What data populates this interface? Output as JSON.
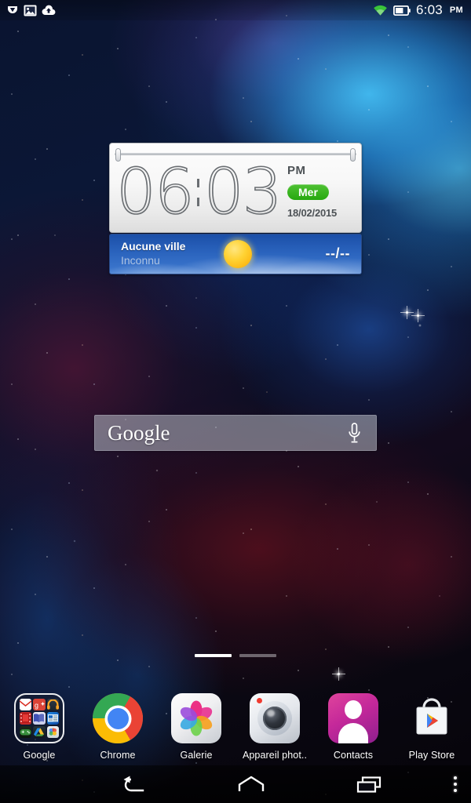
{
  "status_bar": {
    "left_icons": [
      {
        "name": "download-icon",
        "label": "download"
      },
      {
        "name": "image-icon",
        "label": "screenshot"
      },
      {
        "name": "cloud-upload-icon",
        "label": "cloud upload"
      }
    ],
    "right_icons": [
      {
        "name": "wifi-icon",
        "label": "wifi",
        "color": "#3ac43a"
      },
      {
        "name": "battery-icon",
        "label": "battery",
        "color": "#ffffff"
      }
    ],
    "time": "6:03",
    "ampm": "PM"
  },
  "clock_widget": {
    "hours": "06",
    "minutes": "03",
    "ampm": "PM",
    "day_badge": "Mer",
    "day_badge_color": "#34b01a",
    "date": "18/02/2015"
  },
  "weather_widget": {
    "city": "Aucune ville",
    "condition": "Inconnu",
    "icon": "sun-icon",
    "temperature": "--/--",
    "background_color": "#2a63bd"
  },
  "search_bar": {
    "label": "Google",
    "mic_icon": "microphone-icon"
  },
  "page_indicator": {
    "count": 2,
    "active": 0
  },
  "dock": {
    "items": [
      {
        "label": "Google",
        "icon": "google-folder-icon",
        "type": "folder",
        "contents": [
          {
            "name": "gmail-icon",
            "color": "#ffffff"
          },
          {
            "name": "google-plus-icon",
            "color": "#dd4b39"
          },
          {
            "name": "play-music-icon",
            "color": "#ff9800"
          },
          {
            "name": "play-movies-icon",
            "color": "#e53935"
          },
          {
            "name": "play-books-icon",
            "color": "#3f51b5"
          },
          {
            "name": "play-newsstand-icon",
            "color": "#1565c0"
          },
          {
            "name": "play-games-icon",
            "color": "#43a047"
          },
          {
            "name": "google-drive-icon",
            "color": "#fbc02d"
          },
          {
            "name": "google-photos-icon",
            "color": "#4285f4"
          }
        ]
      },
      {
        "label": "Chrome",
        "icon": "chrome-icon",
        "type": "app"
      },
      {
        "label": "Galerie",
        "icon": "gallery-icon",
        "type": "app"
      },
      {
        "label": "Appareil phot..",
        "icon": "camera-icon",
        "type": "app"
      },
      {
        "label": "Contacts",
        "icon": "contacts-icon",
        "type": "app"
      },
      {
        "label": "Play Store",
        "icon": "play-store-icon",
        "type": "app"
      }
    ]
  },
  "nav_bar": {
    "buttons": [
      {
        "name": "back-button",
        "icon": "back-arrow-icon"
      },
      {
        "name": "home-button",
        "icon": "home-icon"
      },
      {
        "name": "recents-button",
        "icon": "recents-icon"
      },
      {
        "name": "menu-button",
        "icon": "overflow-menu-icon"
      }
    ]
  }
}
